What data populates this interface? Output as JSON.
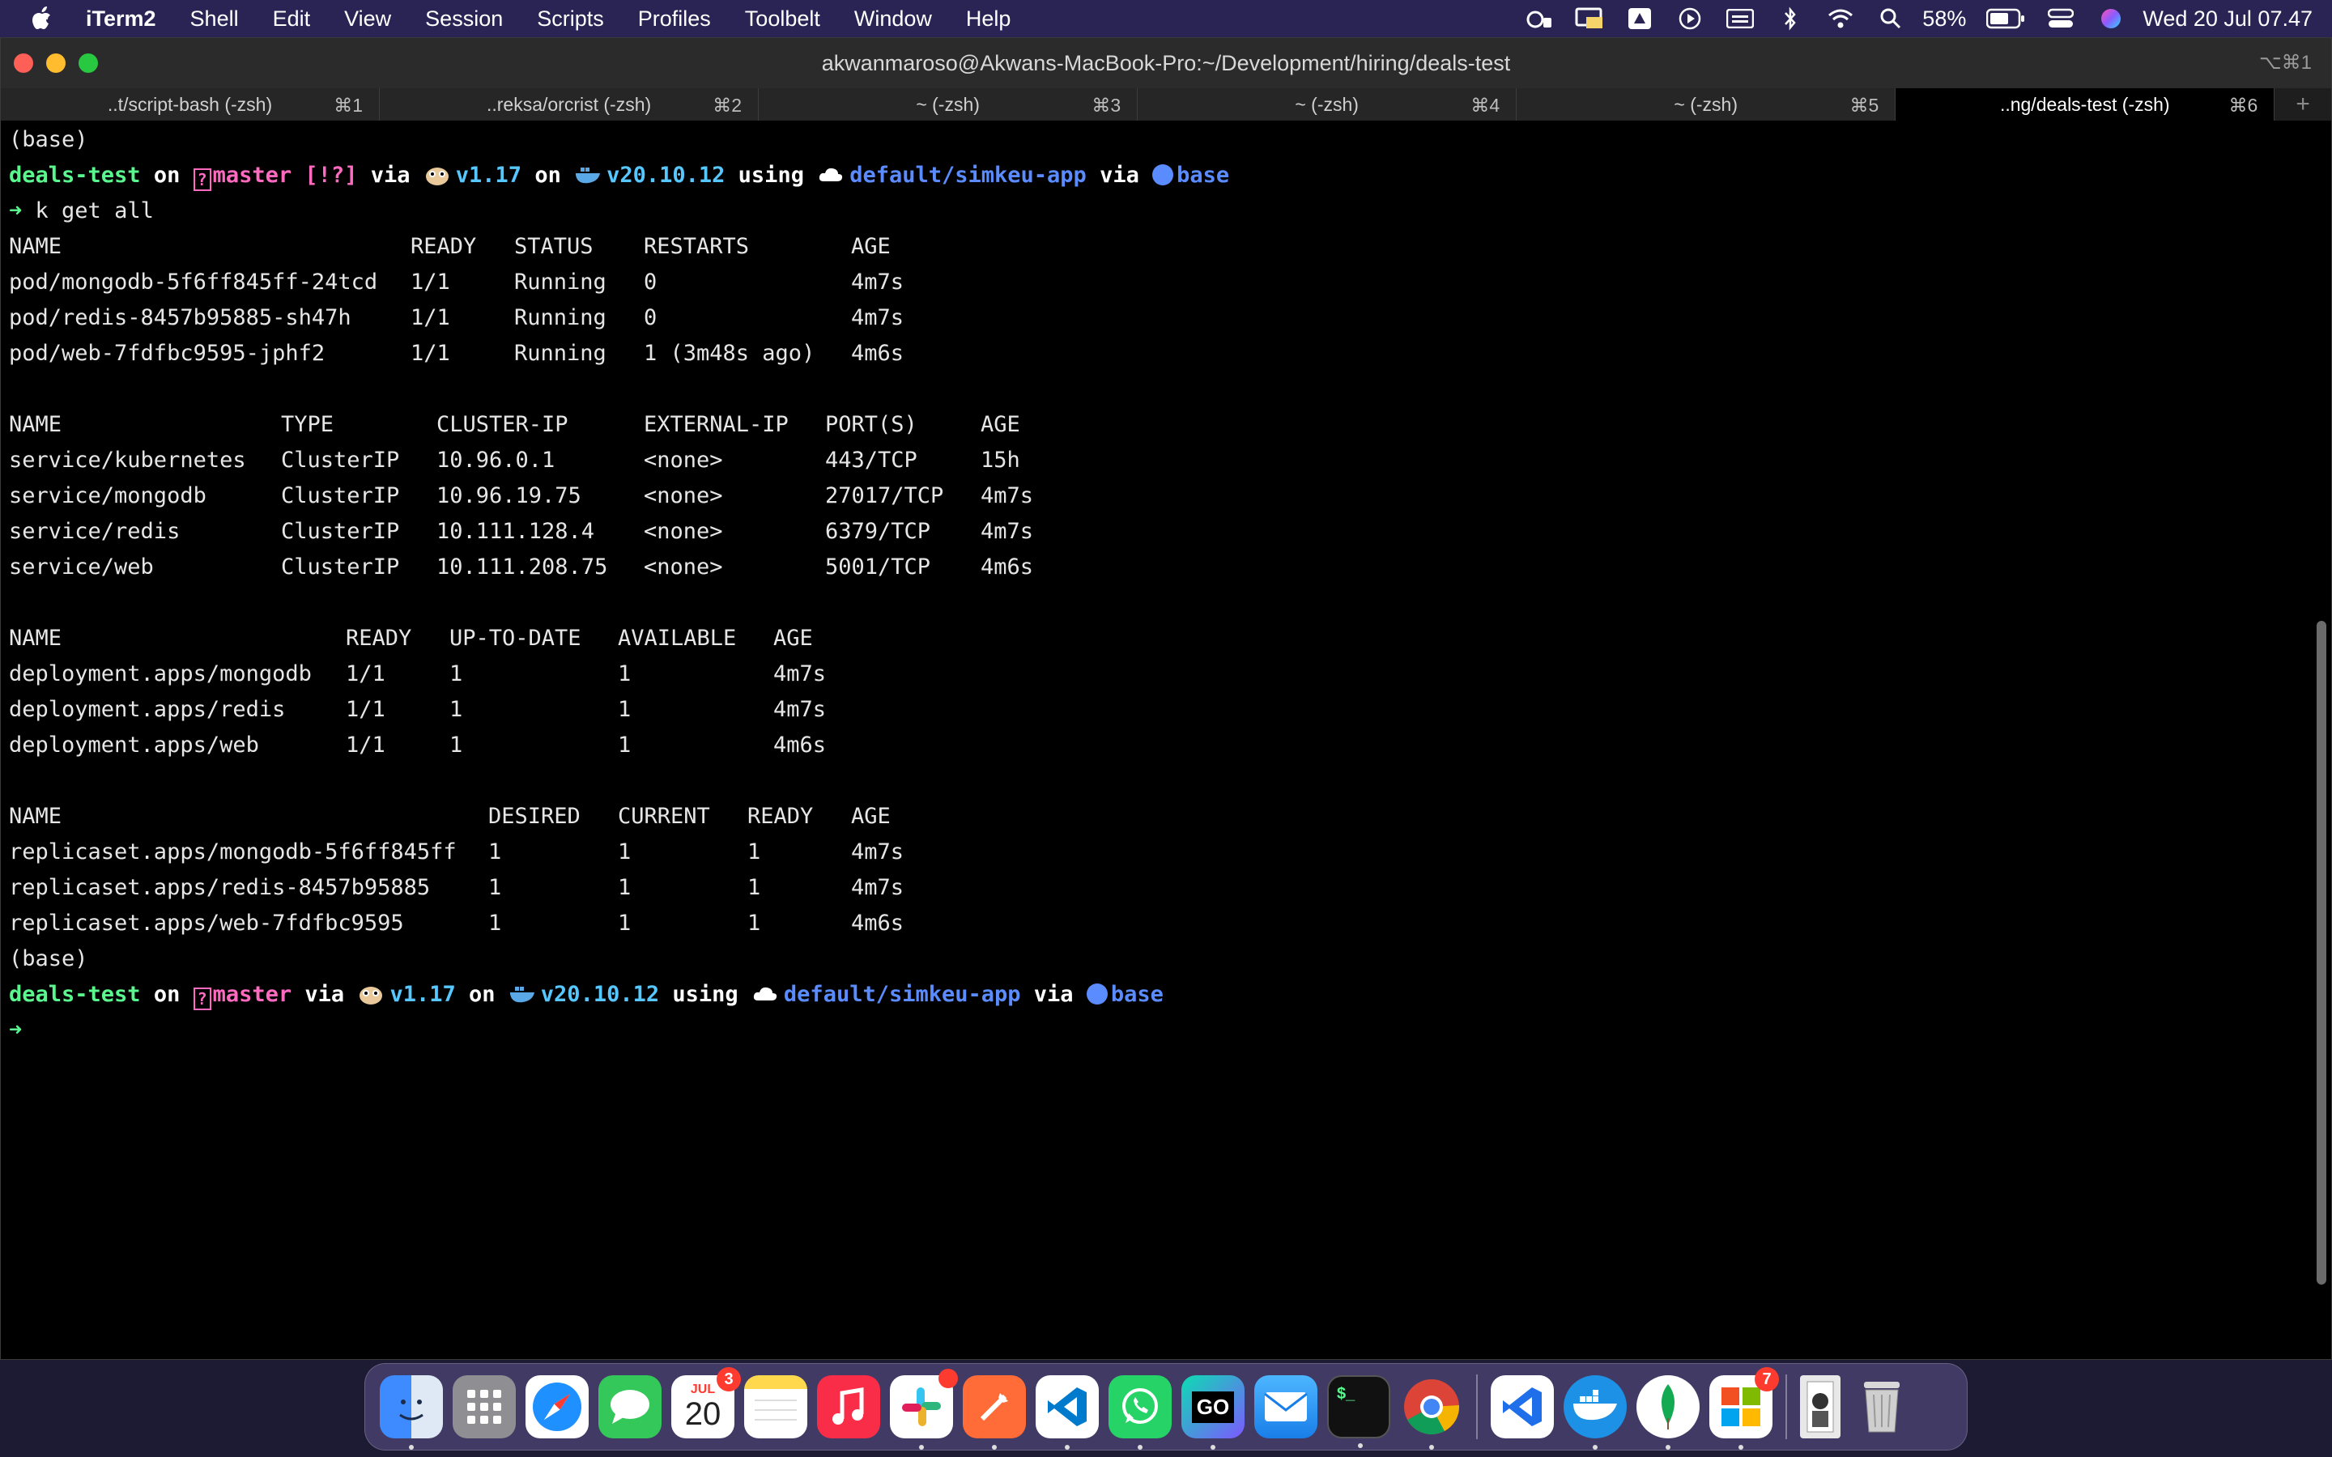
{
  "menubar": {
    "app": "iTerm2",
    "items": [
      "Shell",
      "Edit",
      "View",
      "Session",
      "Scripts",
      "Profiles",
      "Toolbelt",
      "Window",
      "Help"
    ],
    "battery": "58%",
    "clock": "Wed 20 Jul  07.47"
  },
  "window": {
    "title": "akwanmaroso@Akwans-MacBook-Pro:~/Development/hiring/deals-test",
    "shortcut": "⌥⌘1",
    "tabs": [
      {
        "label": "..t/script-bash (-zsh)",
        "shortcut": "⌘1"
      },
      {
        "label": "..reksa/orcrist (-zsh)",
        "shortcut": "⌘2"
      },
      {
        "label": "~ (-zsh)",
        "shortcut": "⌘3"
      },
      {
        "label": "~ (-zsh)",
        "shortcut": "⌘4"
      },
      {
        "label": "~ (-zsh)",
        "shortcut": "⌘5"
      },
      {
        "label": "..ng/deals-test (-zsh)",
        "shortcut": "⌘6"
      }
    ]
  },
  "prompt1": {
    "env": "(base)",
    "dir": "deals-test",
    "on": "on",
    "branch": "master",
    "status": "[!?]",
    "via": "via",
    "go": "v1.17",
    "docker": "v20.10.12",
    "using": "using",
    "context": "default/simkeu-app",
    "conda": "base",
    "arrow": "➜",
    "command": "k get all"
  },
  "pods": {
    "header": [
      "NAME",
      "READY",
      "STATUS",
      "RESTARTS",
      "AGE"
    ],
    "rows": [
      [
        "pod/mongodb-5f6ff845ff-24tcd",
        "1/1",
        "Running",
        "0",
        "4m7s"
      ],
      [
        "pod/redis-8457b95885-sh47h",
        "1/1",
        "Running",
        "0",
        "4m7s"
      ],
      [
        "pod/web-7fdfbc9595-jphf2",
        "1/1",
        "Running",
        "1 (3m48s ago)",
        "4m6s"
      ]
    ]
  },
  "services": {
    "header": [
      "NAME",
      "TYPE",
      "CLUSTER-IP",
      "EXTERNAL-IP",
      "PORT(S)",
      "AGE"
    ],
    "rows": [
      [
        "service/kubernetes",
        "ClusterIP",
        "10.96.0.1",
        "<none>",
        "443/TCP",
        "15h"
      ],
      [
        "service/mongodb",
        "ClusterIP",
        "10.96.19.75",
        "<none>",
        "27017/TCP",
        "4m7s"
      ],
      [
        "service/redis",
        "ClusterIP",
        "10.111.128.4",
        "<none>",
        "6379/TCP",
        "4m7s"
      ],
      [
        "service/web",
        "ClusterIP",
        "10.111.208.75",
        "<none>",
        "5001/TCP",
        "4m6s"
      ]
    ]
  },
  "deployments": {
    "header": [
      "NAME",
      "READY",
      "UP-TO-DATE",
      "AVAILABLE",
      "AGE"
    ],
    "rows": [
      [
        "deployment.apps/mongodb",
        "1/1",
        "1",
        "1",
        "4m7s"
      ],
      [
        "deployment.apps/redis",
        "1/1",
        "1",
        "1",
        "4m7s"
      ],
      [
        "deployment.apps/web",
        "1/1",
        "1",
        "1",
        "4m6s"
      ]
    ]
  },
  "replicasets": {
    "header": [
      "NAME",
      "DESIRED",
      "CURRENT",
      "READY",
      "AGE"
    ],
    "rows": [
      [
        "replicaset.apps/mongodb-5f6ff845ff",
        "1",
        "1",
        "1",
        "4m7s"
      ],
      [
        "replicaset.apps/redis-8457b95885",
        "1",
        "1",
        "1",
        "4m7s"
      ],
      [
        "replicaset.apps/web-7fdfbc9595",
        "1",
        "1",
        "1",
        "4m6s"
      ]
    ]
  },
  "prompt2": {
    "env": "(base)",
    "dir": "deals-test",
    "on": "on",
    "branch": "master",
    "via": "via",
    "go": "v1.17",
    "docker": "v20.10.12",
    "using": "using",
    "context": "default/simkeu-app",
    "conda": "base",
    "arrow": "➜"
  },
  "dock": {
    "calendar_month": "JUL",
    "calendar_day": "20",
    "calendar_badge": "3",
    "goland_label": "GO",
    "terminal_label": "$_",
    "appstore_badge": "7"
  },
  "colors": {
    "green": "#5af78e",
    "magenta": "#ff6ac1",
    "yellow": "#f3f99d",
    "cyan": "#57c7ff",
    "blue": "#5b8cff"
  }
}
